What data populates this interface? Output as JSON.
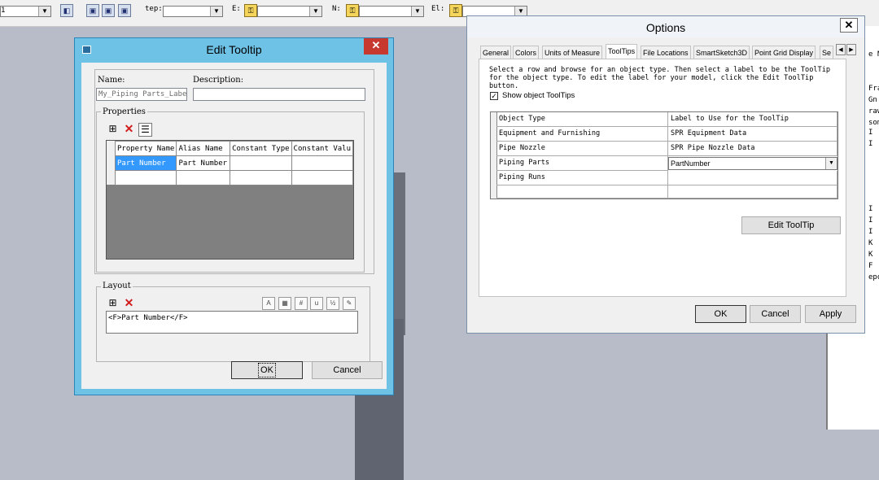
{
  "toolbar": {
    "left_value": "1",
    "step_label": "tep:",
    "e_label": "E:",
    "n_label": "N:",
    "el_label": "El:"
  },
  "side_panel": [
    "e N",
    "Fra",
    "Gn",
    "raw",
    "som",
    "I",
    "I",
    "I",
    "I",
    "I",
    "K",
    "K",
    "F",
    "epo"
  ],
  "edit_tooltip": {
    "title": "Edit Tooltip",
    "name_label": "Name:",
    "name_value": "My_Piping Parts_Label",
    "description_label": "Description:",
    "description_value": "",
    "properties_label": "Properties",
    "columns": [
      "Property Name",
      "Alias Name",
      "Constant Type",
      "Constant Valu"
    ],
    "rows": [
      [
        "Part Number",
        "Part Number",
        "",
        ""
      ],
      [
        "",
        "",
        "",
        ""
      ]
    ],
    "layout_label": "Layout",
    "layout_value": "<F>Part Number</F>",
    "ok_label": "OK",
    "cancel_label": "Cancel"
  },
  "options": {
    "title": "Options",
    "tabs": [
      "General",
      "Colors",
      "Units of Measure",
      "ToolTips",
      "File Locations",
      "SmartSketch3D",
      "Point Grid Display",
      "Se"
    ],
    "active_tab": "ToolTips",
    "description": "Select a row and browse for an object type. Then select a label to be the ToolTip for the object type. To edit the label for your model, click the Edit ToolTip button.",
    "show_tooltips_label": "Show object ToolTips",
    "show_tooltips_checked": true,
    "columns": [
      "Object Type",
      "Label to Use for the ToolTip"
    ],
    "rows": [
      [
        "Equipment and Furnishing",
        "SPR Equipment Data"
      ],
      [
        "Pipe Nozzle",
        "SPR Pipe Nozzle Data"
      ],
      [
        "Piping Parts",
        "PartNumber"
      ],
      [
        "Piping Runs",
        ""
      ]
    ],
    "edit_tooltip_button": "Edit ToolTip",
    "ok_label": "OK",
    "cancel_label": "Cancel",
    "apply_label": "Apply"
  }
}
